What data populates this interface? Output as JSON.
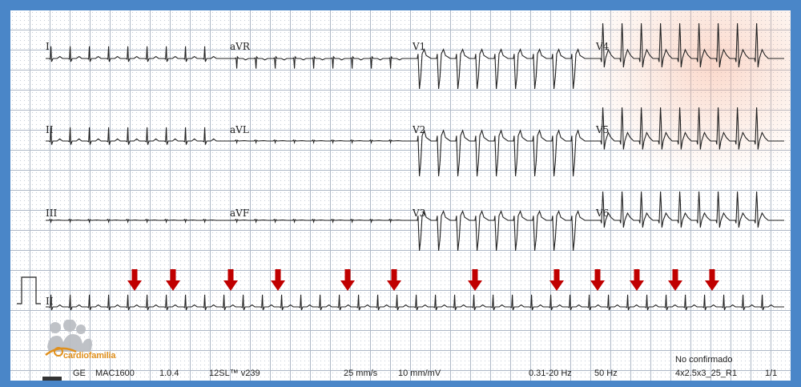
{
  "leads": {
    "row1": [
      "I",
      "aVR",
      "V1",
      "V4"
    ],
    "row2": [
      "II",
      "aVL",
      "V2",
      "V5"
    ],
    "row3": [
      "III",
      "aVF",
      "V3",
      "V6"
    ],
    "rhythm": "II"
  },
  "footer": {
    "manufacturer": "GE",
    "model": "MAC1600",
    "version": "1.0.4",
    "software": "12SL™ v239",
    "speed": "25 mm/s",
    "gain": "10 mm/mV",
    "filter": "0.31-20 Hz",
    "mains": "50 Hz",
    "status": "No confirmado",
    "format": "4x2.5x3_25_R1",
    "page": "1/1"
  },
  "logo": {
    "text": "cardiofamilia"
  },
  "colors": {
    "border": "#4a86c8",
    "grid": "#aeb8c6",
    "trace": "#222222",
    "arrow": "#c00000",
    "logo_accent": "#e0901d"
  },
  "annotations": {
    "arrow_count": 12,
    "arrow_icon": "down-arrow-icon"
  }
}
